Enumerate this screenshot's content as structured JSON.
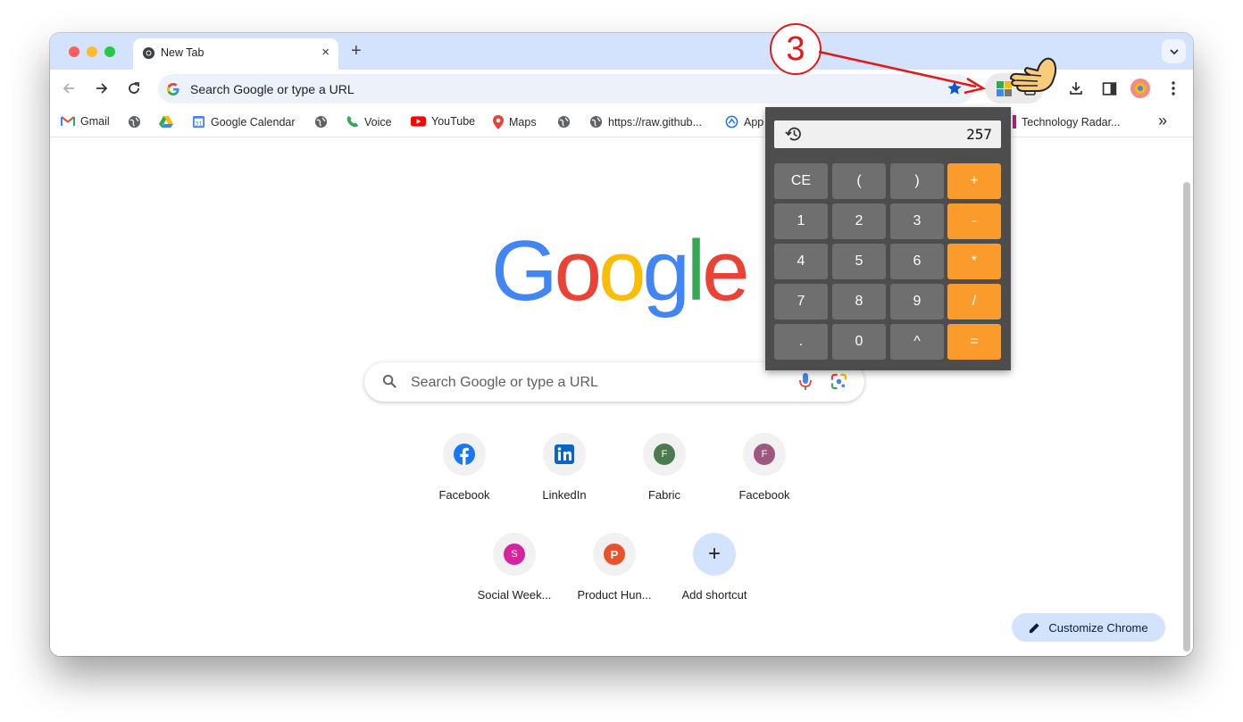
{
  "browser": {
    "tab": {
      "title": "New Tab",
      "favicon": "chrome-icon",
      "close": "×"
    },
    "new_tab": "+",
    "omnibox": {
      "text": "Search Google or type a URL"
    },
    "bookmarks": [
      {
        "label": "Gmail",
        "icon": "gmail-icon"
      },
      {
        "label": "",
        "icon": "globe-icon"
      },
      {
        "label": "",
        "icon": "drive-icon"
      },
      {
        "label": "Google Calendar",
        "icon": "calendar-icon"
      },
      {
        "label": "",
        "icon": "globe-icon"
      },
      {
        "label": "Voice",
        "icon": "voice-icon"
      },
      {
        "label": "YouTube",
        "icon": "youtube-icon"
      },
      {
        "label": "Maps",
        "icon": "maps-icon"
      },
      {
        "label": "",
        "icon": "globe-icon"
      },
      {
        "label": "https://raw.github...",
        "icon": "globe-icon"
      },
      {
        "label": "App",
        "icon": "app-icon"
      },
      {
        "label": "Technology Radar...",
        "icon": "radar-icon"
      }
    ],
    "more_bookmarks": "»"
  },
  "page": {
    "logo": [
      "G",
      "o",
      "o",
      "g",
      "l",
      "e"
    ],
    "search_placeholder": "Search Google or type a URL",
    "shortcuts": [
      {
        "label": "Facebook",
        "letter": ""
      },
      {
        "label": "LinkedIn",
        "letter": ""
      },
      {
        "label": "Fabric",
        "letter": "F"
      },
      {
        "label": "Facebook",
        "letter": "F"
      },
      {
        "label": "Social Week...",
        "letter": "S"
      },
      {
        "label": "Product Hun...",
        "letter": "P"
      },
      {
        "label": "Add shortcut",
        "letter": "+"
      }
    ],
    "customize": "Customize Chrome"
  },
  "calculator": {
    "display": "257",
    "keys": [
      "CE",
      "(",
      ")",
      "+",
      "1",
      "2",
      "3",
      "-",
      "4",
      "5",
      "6",
      "*",
      "7",
      "8",
      "9",
      "/",
      ".",
      "0",
      "^",
      "="
    ]
  },
  "annotation": {
    "step": "3"
  },
  "colors": {
    "tabbar": "#d3e3fd",
    "operator_key": "#fb9b2c",
    "number_key": "#6f6f6f",
    "annotation": "#e11919"
  }
}
